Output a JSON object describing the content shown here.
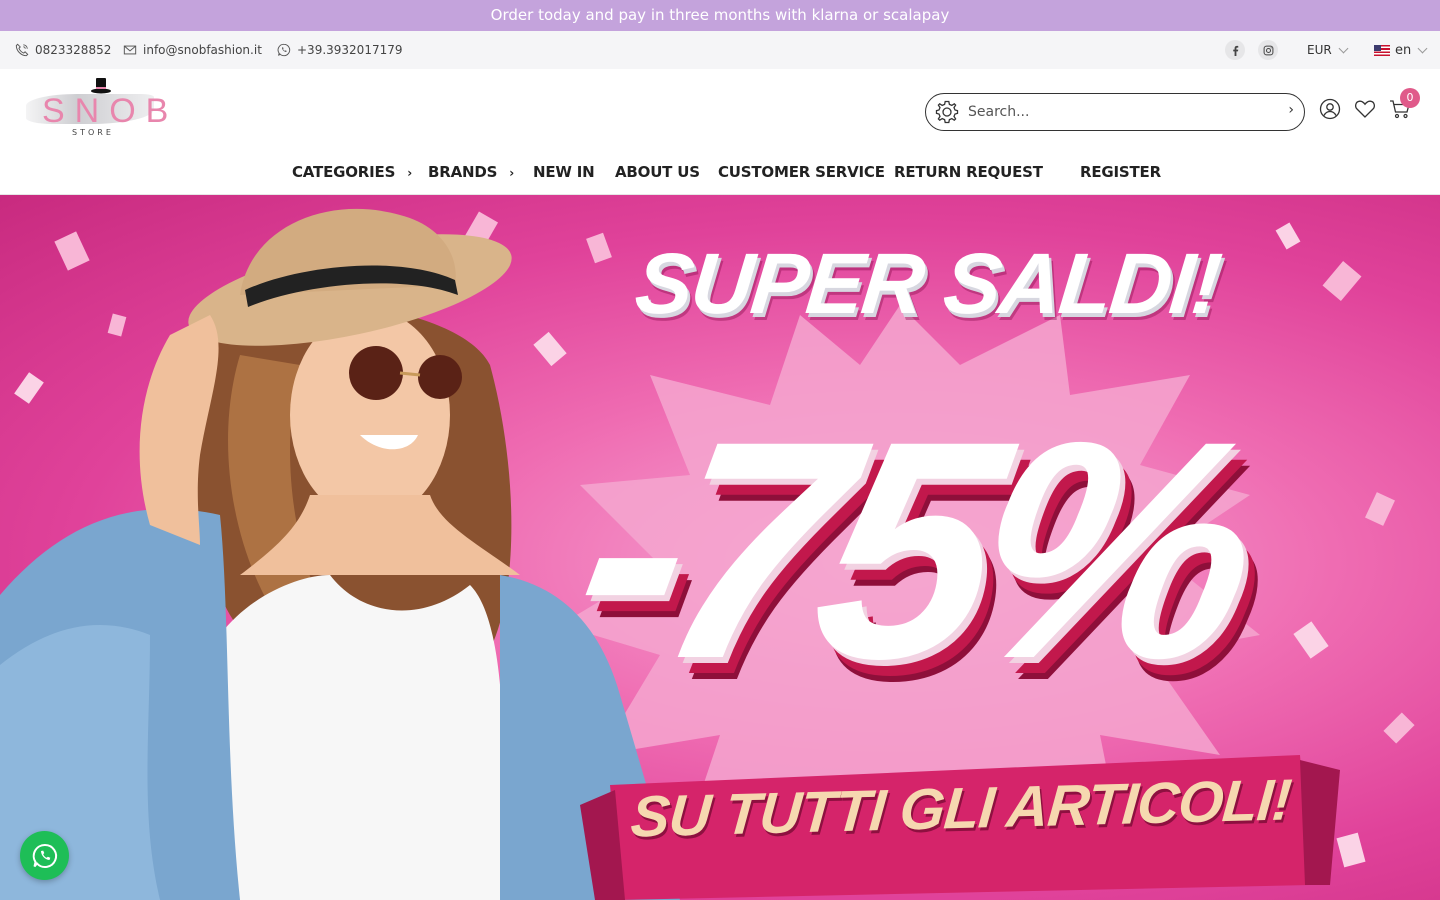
{
  "announcement": {
    "text": "Order today and pay in three months with klarna or scalapay"
  },
  "topbar": {
    "phone": "0823328852",
    "email": "info@snobfashion.it",
    "whatsapp": "+39.3932017179",
    "currency": "EUR",
    "language": "en",
    "social": [
      "facebook-icon",
      "instagram-icon"
    ]
  },
  "header": {
    "logo_text": "SNOB",
    "logo_subtext": "STORE",
    "search_placeholder": "Search...",
    "search_go": "›",
    "cart_count": "0"
  },
  "nav": {
    "items": [
      {
        "label": "CATEGORIES",
        "has_submenu": true
      },
      {
        "label": "BRANDS",
        "has_submenu": true
      },
      {
        "label": "NEW IN",
        "has_submenu": false
      },
      {
        "label": "ABOUT US",
        "has_submenu": false
      },
      {
        "label": "CUSTOMER SERVICE",
        "has_submenu": false
      },
      {
        "label": "RETURN REQUEST",
        "has_submenu": false
      },
      {
        "label": "REGISTER",
        "has_submenu": false
      }
    ],
    "submenu_arrow": "›"
  },
  "hero": {
    "headline": "SUPER SALDI!",
    "discount": "-75%",
    "subline": "SU TUTTI GLI ARTICOLI!"
  },
  "colors": {
    "announcement_bg": "#c4a3dc",
    "topbar_bg": "#f5f5f7",
    "accent_pink": "#e05a8a",
    "whatsapp_green": "#1ebe57"
  }
}
